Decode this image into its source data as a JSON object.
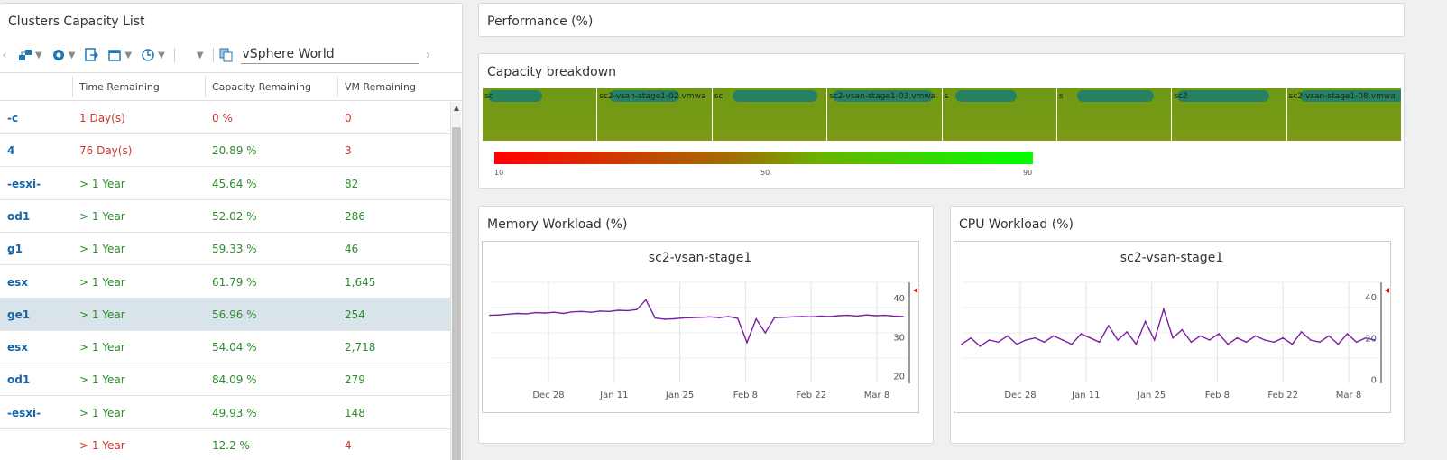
{
  "list_panel": {
    "title": "Clusters Capacity List",
    "scope": "vSphere World",
    "columns": [
      "Time Remaining",
      "Capacity Remaining",
      "VM Remaining"
    ],
    "rows": [
      {
        "name": "-c",
        "time": "1 Day(s)",
        "capacity": "0 %",
        "vm": "0",
        "status": "red"
      },
      {
        "name": "4",
        "time": "76 Day(s)",
        "capacity": "20.89 %",
        "vm": "3",
        "status": "mixed"
      },
      {
        "name": "-esxi-",
        "time": "> 1 Year",
        "capacity": "45.64 %",
        "vm": "82",
        "status": "green"
      },
      {
        "name": "od1",
        "time": "> 1 Year",
        "capacity": "52.02 %",
        "vm": "286",
        "status": "green"
      },
      {
        "name": "g1",
        "time": "> 1 Year",
        "capacity": "59.33 %",
        "vm": "46",
        "status": "green"
      },
      {
        "name": "esx",
        "time": "> 1 Year",
        "capacity": "61.79 %",
        "vm": "1,645",
        "status": "green"
      },
      {
        "name": "ge1",
        "time": "> 1 Year",
        "capacity": "56.96 %",
        "vm": "254",
        "status": "green",
        "selected": true
      },
      {
        "name": "esx",
        "time": "> 1 Year",
        "capacity": "54.04 %",
        "vm": "2,718",
        "status": "green"
      },
      {
        "name": "od1",
        "time": "> 1 Year",
        "capacity": "84.09 %",
        "vm": "279",
        "status": "green"
      },
      {
        "name": "-esxi-",
        "time": "> 1 Year",
        "capacity": "49.93 %",
        "vm": "148",
        "status": "green"
      },
      {
        "name": "",
        "time": "> 1 Year",
        "capacity": "12.2 %",
        "vm": "4",
        "status": "mixed"
      }
    ]
  },
  "performance": {
    "title": "Performance (%)"
  },
  "capacity_breakdown": {
    "title": "Capacity breakdown",
    "cells": [
      "sc",
      "sc2-vsan-stage1-02.vmwa",
      "sc",
      "sc2-vsan-stage1-03.vmwa",
      "s",
      "s",
      "sc2",
      "sc2-vsan-stage1-08.vmwa"
    ],
    "legend_labels": [
      "10",
      "50",
      "90"
    ]
  },
  "memory_chart": {
    "title": "Memory Workload (%)",
    "chart_title": "sc2-vsan-stage1",
    "x_ticks": [
      "Dec 28",
      "Jan 11",
      "Jan 25",
      "Feb 8",
      "Feb 22",
      "Mar 8"
    ],
    "y_ticks": [
      "40",
      "30",
      "20"
    ]
  },
  "cpu_chart": {
    "title": "CPU Workload (%)",
    "chart_title": "sc2-vsan-stage1",
    "x_ticks": [
      "Dec 28",
      "Jan 11",
      "Jan 25",
      "Feb 8",
      "Feb 22",
      "Mar 8"
    ],
    "y_ticks": [
      "40",
      "20",
      "0"
    ]
  },
  "chart_data": [
    {
      "type": "line",
      "title": "sc2-vsan-stage1",
      "xlabel": "",
      "ylabel": "",
      "x": [
        "Dec 28",
        "Jan 11",
        "Jan 25",
        "Feb 8",
        "Feb 22",
        "Mar 8"
      ],
      "ylim": [
        18,
        44
      ],
      "series": [
        {
          "values": [
            35.5,
            35.6,
            35.8,
            36.0,
            35.9,
            36.2,
            36.1,
            36.3,
            36.0,
            36.4,
            36.5,
            36.3,
            36.6,
            36.5,
            36.8,
            36.7,
            37.0,
            39.5,
            34.8,
            34.5,
            34.6,
            34.8,
            34.9,
            35.0,
            35.1,
            34.9,
            35.2,
            34.7,
            28.5,
            34.6,
            31.0,
            34.9,
            35.0,
            35.1,
            35.2,
            35.1,
            35.3,
            35.2,
            35.4,
            35.5,
            35.3,
            35.6,
            35.4,
            35.5,
            35.3,
            35.2
          ]
        }
      ]
    },
    {
      "type": "line",
      "title": "sc2-vsan-stage1",
      "xlabel": "",
      "ylabel": "",
      "x": [
        "Dec 28",
        "Jan 11",
        "Jan 25",
        "Feb 8",
        "Feb 22",
        "Mar 8"
      ],
      "ylim": [
        -2,
        47
      ],
      "series": [
        {
          "values": [
            17,
            20,
            16,
            19,
            18,
            21,
            17,
            19,
            20,
            18,
            21,
            19,
            17,
            22,
            20,
            18,
            26,
            19,
            23,
            17,
            28,
            19,
            34,
            20,
            24,
            18,
            21,
            19,
            22,
            17,
            20,
            18,
            21,
            19,
            18,
            20,
            17,
            23,
            19,
            18,
            21,
            17,
            22,
            18,
            20,
            19
          ]
        }
      ]
    }
  ]
}
